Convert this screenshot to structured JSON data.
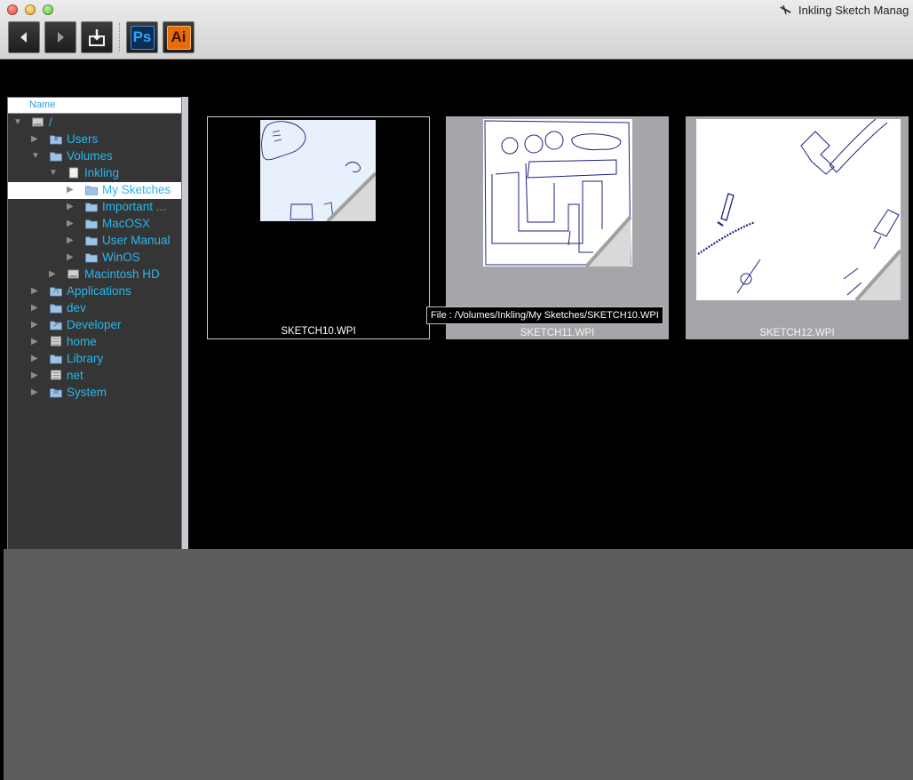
{
  "window": {
    "title": "Inkling Sketch Manag"
  },
  "toolbar": {
    "back_label": "Back",
    "forward_label": "Forward",
    "export_label": "Export",
    "photoshop_label": "Ps",
    "illustrator_label": "Ai"
  },
  "tree": {
    "header": "Name",
    "items": [
      {
        "label": "/",
        "icon": "drive-icon",
        "expanded": true
      },
      {
        "label": "Users",
        "icon": "users-folder-icon",
        "expanded": false
      },
      {
        "label": "Volumes",
        "icon": "folder-icon",
        "expanded": true
      },
      {
        "label": "Inkling",
        "icon": "volume-icon",
        "expanded": true
      },
      {
        "label": "My Sketches",
        "icon": "folder-icon",
        "expanded": false,
        "selected": true
      },
      {
        "label": "Important ...",
        "icon": "folder-icon",
        "expanded": false
      },
      {
        "label": "MacOSX",
        "icon": "folder-icon",
        "expanded": false
      },
      {
        "label": "User Manual",
        "icon": "folder-icon",
        "expanded": false
      },
      {
        "label": "WinOS",
        "icon": "folder-icon",
        "expanded": false
      },
      {
        "label": "Macintosh HD",
        "icon": "drive-icon",
        "expanded": false
      },
      {
        "label": "Applications",
        "icon": "applications-folder-icon",
        "expanded": false
      },
      {
        "label": "dev",
        "icon": "folder-icon",
        "expanded": false
      },
      {
        "label": "Developer",
        "icon": "developer-folder-icon",
        "expanded": false
      },
      {
        "label": "home",
        "icon": "network-icon",
        "expanded": false
      },
      {
        "label": "Library",
        "icon": "folder-icon",
        "expanded": false
      },
      {
        "label": "net",
        "icon": "network-icon",
        "expanded": false
      },
      {
        "label": "System",
        "icon": "system-folder-icon",
        "expanded": false
      }
    ]
  },
  "thumbnails": [
    {
      "filename": "SKETCH10.WPI",
      "selected": true
    },
    {
      "filename": "SKETCH11.WPI",
      "selected": false
    },
    {
      "filename": "SKETCH12.WPI",
      "selected": false
    }
  ],
  "tooltip": {
    "text": "File : /Volumes/Inkling/My Sketches/SKETCH10.WPI"
  },
  "colors": {
    "tree_background": "#353535",
    "tree_text": "#28b8ec",
    "sketch_ink": "#1a237e",
    "bottom_pane": "#5c5c5c"
  }
}
